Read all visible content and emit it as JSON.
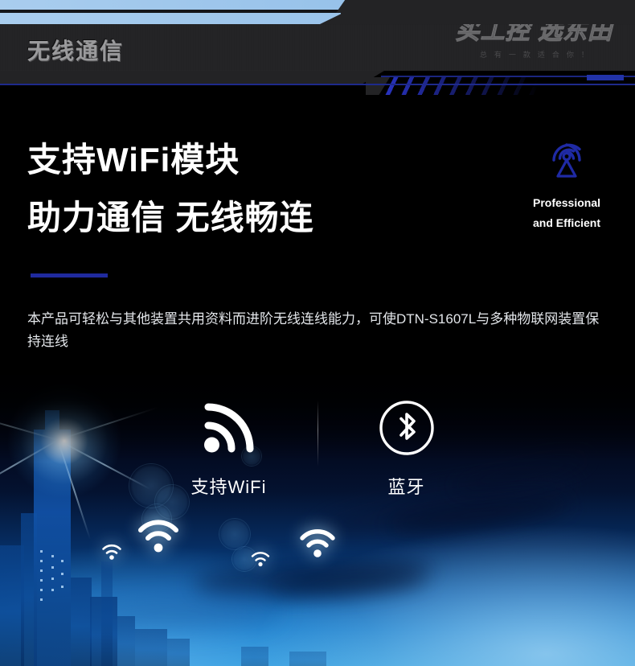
{
  "header": {
    "section_title": "无线通信",
    "logo_main": "买工控 选东田",
    "logo_tagline": "总有一款适合你！"
  },
  "hero": {
    "heading_line1": "支持WiFi模块",
    "heading_line2": "助力通信 无线畅连",
    "description": "本产品可轻松与其他装置共用资料而进阶无线连线能力，可使DTN-S1607L与多种物联网装置保持连线",
    "badge": {
      "icon": "broadcast-tower-icon",
      "caption_line1": "Professional",
      "caption_line2": "and Efficient"
    }
  },
  "features": [
    {
      "icon": "wifi-signal-icon",
      "label": "支持WiFi"
    },
    {
      "icon": "bluetooth-icon",
      "label": "蓝牙"
    }
  ],
  "colors": {
    "accent_blue": "#1f2a9e",
    "band_light_blue": "#a9cdee",
    "header_dark": "#232325",
    "title_gray": "#9a9a9c",
    "text_white": "#ffffff",
    "city_blue": "#0a57a5"
  }
}
